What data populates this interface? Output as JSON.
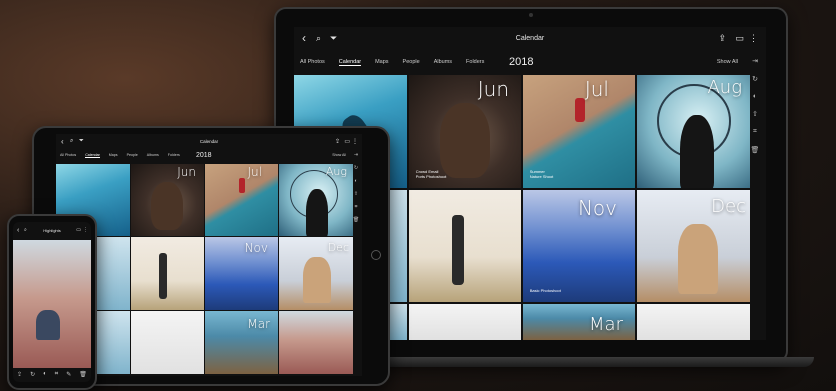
{
  "laptop": {
    "title": "Calendar",
    "year": "2018",
    "tabs": [
      {
        "label": "All Photos",
        "active": false
      },
      {
        "label": "Calendar",
        "active": true
      },
      {
        "label": "Maps",
        "active": false
      },
      {
        "label": "People",
        "active": false
      },
      {
        "label": "Albums",
        "active": false
      },
      {
        "label": "Folders",
        "active": false
      }
    ],
    "show_all": "Show All",
    "months": [
      "Jun",
      "Jul",
      "Aug",
      "Nov",
      "Dec",
      "Mar"
    ],
    "captions": {
      "jun_line1": "Crowd Email",
      "jun_line2": "Ports Photoshoot",
      "jul_line1": "Summer",
      "jul_line2": "Nature Shoot",
      "nov_line1": "Basic Photoshoot"
    }
  },
  "tablet": {
    "title": "Calendar",
    "year": "2018",
    "tabs": [
      {
        "label": "All Photos",
        "active": false
      },
      {
        "label": "Calendar",
        "active": true
      },
      {
        "label": "Maps",
        "active": false
      },
      {
        "label": "People",
        "active": false
      },
      {
        "label": "Albums",
        "active": false
      },
      {
        "label": "Folders",
        "active": false
      }
    ],
    "show_all": "Show All",
    "months": [
      "Jun",
      "Jul",
      "Aug",
      "Nov",
      "Dec",
      "Mar"
    ]
  },
  "phone": {
    "title": "Highlights"
  },
  "icons": {
    "back": "chevron-left-icon",
    "search": "search-icon",
    "filter": "filter-icon",
    "share": "share-icon",
    "info": "info-icon",
    "more": "more-icon"
  }
}
